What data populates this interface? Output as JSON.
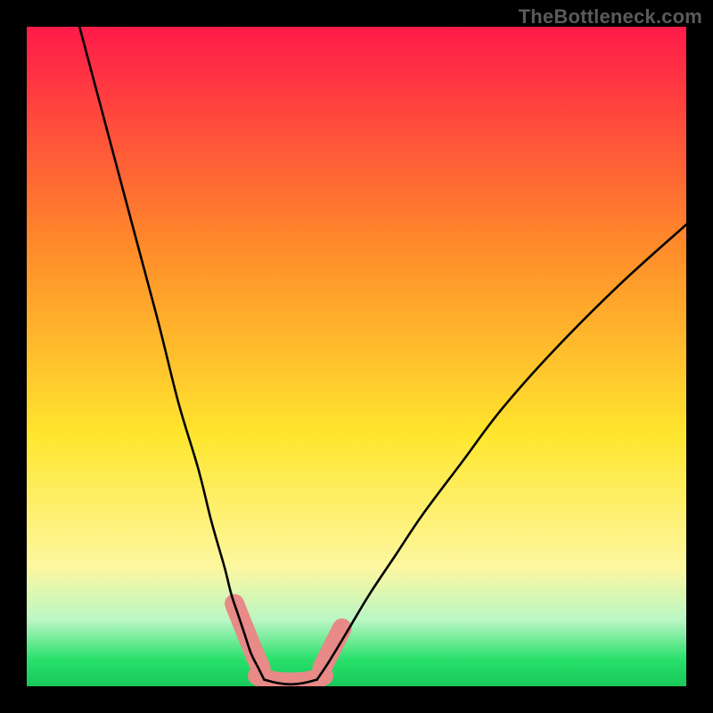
{
  "watermark": {
    "text": "TheBottleneck.com"
  },
  "plot": {
    "gradient_colors": {
      "top": "#ff1a4a",
      "orange": "#ff8a2a",
      "yellow": "#ffe62e",
      "paleyellow": "#fdf7a0",
      "mint": "#b9f7c4",
      "green": "#27e06a",
      "darkgreen": "#18c95a"
    }
  },
  "chart_data": {
    "type": "line",
    "title": "",
    "xlabel": "",
    "ylabel": "",
    "xlim": [
      0,
      100
    ],
    "ylim": [
      0,
      100
    ],
    "series": [
      {
        "name": "left-curve",
        "x": [
          8,
          12,
          16,
          20,
          23,
          26,
          28,
          30,
          31,
          32,
          33,
          34,
          35,
          36
        ],
        "values": [
          100,
          85,
          70,
          55,
          43,
          33,
          25,
          18,
          14,
          11,
          8,
          5,
          3,
          1
        ]
      },
      {
        "name": "right-curve",
        "x": [
          44,
          46,
          49,
          52,
          56,
          60,
          66,
          72,
          80,
          90,
          100
        ],
        "values": [
          1,
          4,
          9,
          14,
          20,
          26,
          34,
          42,
          51,
          61,
          70
        ]
      },
      {
        "name": "bottom-connector",
        "x": [
          36,
          38,
          40,
          42,
          44
        ],
        "values": [
          1,
          0.5,
          0.3,
          0.5,
          1
        ]
      },
      {
        "name": "marker-band-left",
        "x": [
          31.5,
          32.3,
          33.1,
          33.9,
          34.7,
          35.5
        ],
        "values": [
          12.5,
          10.5,
          8.5,
          6.5,
          4.5,
          2.8
        ]
      },
      {
        "name": "marker-band-right",
        "x": [
          44.8,
          45.8,
          46.8,
          47.8
        ],
        "values": [
          2.8,
          4.8,
          6.8,
          8.8
        ]
      },
      {
        "name": "marker-band-bottom",
        "x": [
          35,
          36.5,
          38,
          40,
          42,
          43.5,
          45
        ],
        "values": [
          1.6,
          1.0,
          0.7,
          0.6,
          0.7,
          1.0,
          1.6
        ]
      }
    ],
    "legend": [],
    "grid": false
  }
}
